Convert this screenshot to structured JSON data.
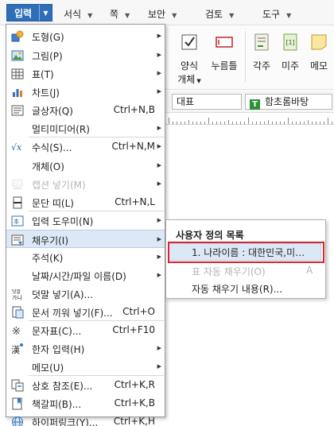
{
  "menubar": {
    "active_label": "입력",
    "items": [
      "서식",
      "쪽",
      "보안",
      "검토",
      "도구"
    ]
  },
  "ribbon": {
    "buttons": [
      {
        "label": "양식\n개체",
        "icon": "form-object-icon"
      },
      {
        "label": "누름틀",
        "icon": "click-field-icon"
      },
      {
        "label": "각주",
        "icon": "footnote-icon"
      },
      {
        "label": "미주",
        "icon": "endnote-icon"
      },
      {
        "label": "메모",
        "icon": "memo-icon"
      }
    ],
    "form_label_line1": "양식",
    "form_label_line2": "개체",
    "field_label": "누름틀",
    "footnote_label": "각주",
    "endnote_label": "미주",
    "memo_label": "메모"
  },
  "format_bar": {
    "style_value": "대표",
    "font_value": "함초롬바탕",
    "font_badge": "T"
  },
  "menu": {
    "items": [
      {
        "label": "도형(G)",
        "shortcut": "",
        "submenu": true,
        "icon": "shape-icon",
        "disabled": false
      },
      {
        "label": "그림(P)",
        "shortcut": "",
        "submenu": true,
        "icon": "picture-icon",
        "disabled": false
      },
      {
        "label": "표(T)",
        "shortcut": "",
        "submenu": true,
        "icon": "table-icon",
        "disabled": false
      },
      {
        "label": "차트(J)",
        "shortcut": "",
        "submenu": true,
        "icon": "chart-icon",
        "disabled": false
      },
      {
        "label": "글상자(Q)",
        "shortcut": "Ctrl+N,B",
        "submenu": false,
        "icon": "textbox-icon",
        "disabled": false
      },
      {
        "label": "멀티미디어(R)",
        "shortcut": "",
        "submenu": true,
        "icon": "",
        "disabled": false
      },
      {
        "label": "수식(S)...",
        "shortcut": "Ctrl+N,M",
        "submenu": true,
        "icon": "formula-icon",
        "disabled": false
      },
      {
        "label": "개체(O)",
        "shortcut": "",
        "submenu": true,
        "icon": "",
        "disabled": false
      },
      {
        "label": "캡션 넣기(M)",
        "shortcut": "",
        "submenu": true,
        "icon": "caption-icon",
        "disabled": true
      },
      {
        "label": "문단 띠(L)",
        "shortcut": "Ctrl+N,L",
        "submenu": false,
        "icon": "paragraph-band-icon",
        "disabled": false
      },
      {
        "label": "입력 도우미(N)",
        "shortcut": "",
        "submenu": true,
        "icon": "input-helper-icon",
        "disabled": false
      },
      {
        "label": "채우기(I)",
        "shortcut": "",
        "submenu": true,
        "icon": "fill-icon",
        "disabled": false
      },
      {
        "label": "주석(K)",
        "shortcut": "",
        "submenu": true,
        "icon": "",
        "disabled": false
      },
      {
        "label": "날짜/시간/파일 이름(D)",
        "shortcut": "",
        "submenu": true,
        "icon": "",
        "disabled": false
      },
      {
        "label": "덧말 넣기(A)...",
        "shortcut": "",
        "submenu": false,
        "icon": "ruby-text-icon",
        "disabled": false
      },
      {
        "label": "문서 끼워 넣기(F)...",
        "shortcut": "Ctrl+O",
        "submenu": false,
        "icon": "insert-document-icon",
        "disabled": false
      },
      {
        "label": "문자표(C)...",
        "shortcut": "Ctrl+F10",
        "submenu": false,
        "icon": "symbol-icon",
        "disabled": false
      },
      {
        "label": "한자 입력(H)",
        "shortcut": "",
        "submenu": true,
        "icon": "hanja-icon",
        "disabled": false
      },
      {
        "label": "메모(U)",
        "shortcut": "",
        "submenu": true,
        "icon": "",
        "disabled": false
      },
      {
        "label": "상호 참조(E)...",
        "shortcut": "Ctrl+K,R",
        "submenu": false,
        "icon": "cross-reference-icon",
        "disabled": false
      },
      {
        "label": "책갈피(B)...",
        "shortcut": "Ctrl+K,B",
        "submenu": false,
        "icon": "bookmark-icon",
        "disabled": false
      },
      {
        "label": "하이퍼링크(Y)...",
        "shortcut": "Ctrl+K,H",
        "submenu": false,
        "icon": "hyperlink-icon",
        "disabled": false
      }
    ]
  },
  "submenu": {
    "title": "사용자 정의 목록",
    "selected_item": "1. 나라이름 : 대한민국,미…",
    "disabled_item": "표 자동 채우기(O)",
    "disabled_shortcut": "A",
    "last_item": "자동 채우기 내용(R)..."
  },
  "colors": {
    "accent": "#2f6fb8",
    "highlight": "#dde8f6",
    "annotation_red": "#d9242b"
  }
}
